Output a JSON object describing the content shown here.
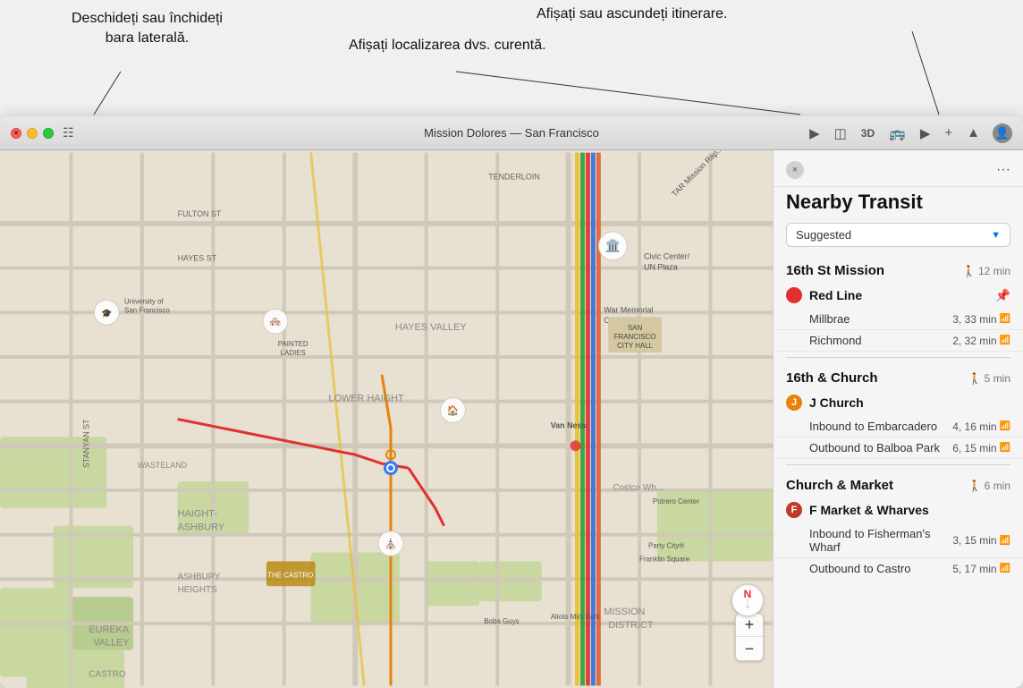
{
  "annotations": {
    "sidebar_label_line1": "Deschideți sau închideți",
    "sidebar_label_line2": "bara laterală.",
    "location_label": "Afișați localizarea dvs. curentă.",
    "itinerary_label": "Afișați sau ascundeți itinerare."
  },
  "titlebar": {
    "title": "Mission Dolores — San Francisco",
    "sidebar_icon": "⊞",
    "btn_location": "◎",
    "btn_3d": "3D",
    "btn_transit": "🚌",
    "btn_info": "ⓘ",
    "btn_add": "+",
    "btn_share": "↑",
    "btn_user": "👤"
  },
  "transit_panel": {
    "title": "Nearby Transit",
    "dropdown_label": "Suggested",
    "close_label": "×",
    "more_label": "···",
    "stations": [
      {
        "name": "16th St Mission",
        "walk": "12 min",
        "walk_icon": "🚶",
        "routes": [
          {
            "name": "Red Line",
            "color": "#e03030",
            "letter": "",
            "pinned": true,
            "destinations": [
              {
                "dest": "Millbrae",
                "time": "3, 33 min"
              },
              {
                "dest": "Richmond",
                "time": "2, 32 min"
              }
            ]
          }
        ]
      },
      {
        "name": "16th & Church",
        "walk": "5 min",
        "walk_icon": "🚶",
        "routes": [
          {
            "name": "J Church",
            "color": "#e8820a",
            "letter": "J",
            "pinned": false,
            "destinations": [
              {
                "dest": "Inbound to Embarcadero",
                "time": "4, 16 min"
              },
              {
                "dest": "Outbound to Balboa Park",
                "time": "6, 15 min"
              }
            ]
          }
        ]
      },
      {
        "name": "Church & Market",
        "walk": "6 min",
        "walk_icon": "🚶",
        "routes": [
          {
            "name": "F Market & Wharves",
            "color": "#c0392b",
            "letter": "F",
            "pinned": false,
            "destinations": [
              {
                "dest": "Inbound to Fisherman's Wharf",
                "time": "3, 15 min"
              },
              {
                "dest": "Outbound to Castro",
                "time": "5, 17 min"
              }
            ]
          }
        ]
      }
    ]
  },
  "map": {
    "zoom_plus": "+",
    "zoom_minus": "−",
    "compass_label": "N"
  }
}
